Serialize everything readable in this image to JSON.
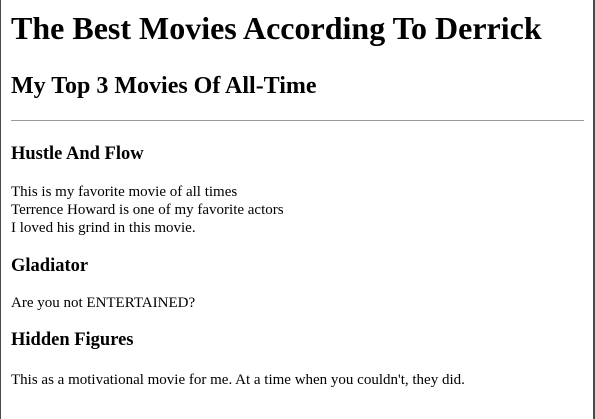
{
  "page": {
    "title": "The Best Movies According To Derrick",
    "subtitle": "My Top 3 Movies Of All-Time"
  },
  "movies": [
    {
      "title": "Hustle And Flow",
      "lines": [
        "This is my favorite movie of all times",
        "Terrence Howard is one of my favorite actors",
        "I loved his grind in this movie."
      ]
    },
    {
      "title": "Gladiator",
      "lines": [
        "Are you not ENTERTAINED?"
      ]
    },
    {
      "title": "Hidden Figures",
      "lines": [
        "This as a motivational movie for me. At a time when you couldn't, they did."
      ]
    }
  ]
}
